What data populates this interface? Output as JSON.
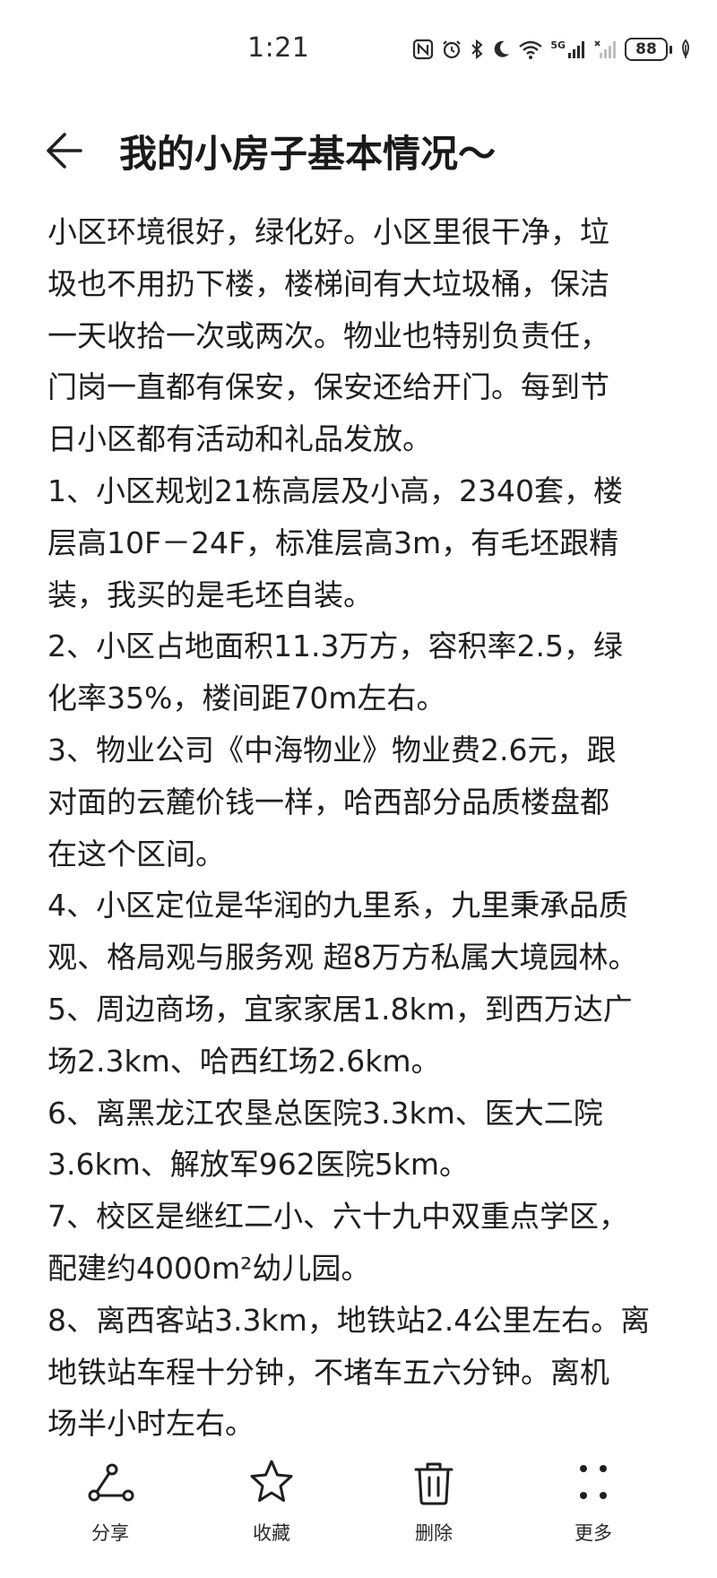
{
  "status_bar": {
    "time": "1:21",
    "battery": "88",
    "network": "5G"
  },
  "header": {
    "title": "我的小房子基本情况～"
  },
  "content": {
    "paragraphs": [
      [
        "小区环境很好，绿化好。小区里很干净，垃",
        "圾也不用扔下楼，楼梯间有大垃圾桶，保洁",
        "一天收拾一次或两次。物业也特别负责任，",
        "门岗一直都有保安，保安还给开门。每到节",
        "日小区都有活动和礼品发放。"
      ],
      [
        "1、小区规划21栋高层及小高，2340套，楼",
        "层高10F－24F，标准层高3m，有毛坯跟精",
        "装，我买的是毛坯自装。"
      ],
      [
        "2、小区占地面积11.3万方，容积率2.5，绿",
        "化率35%，楼间距70m左右。"
      ],
      [
        "3、物业公司《中海物业》物业费2.6元，跟",
        "对面的云麓价钱一样，哈西部分品质楼盘都",
        "在这个区间。"
      ],
      [
        "4、小区定位是华润的九里系，九里秉承品质",
        "观、格局观与服务观 超8万方私属大境园林。"
      ],
      [
        "5、周边商场，宜家家居1.8km，到西万达广",
        "场2.3km、哈西红场2.6km。"
      ],
      [
        "6、离黑龙江农垦总医院3.3km、医大二院",
        "3.6km、解放军962医院5km。"
      ],
      [
        "7、校区是继红二小、六十九中双重点学区，",
        "配建约4000m²幼儿园。"
      ],
      [
        "8、离西客站3.3km，地铁站2.4公里左右。离",
        "地铁站车程十分钟，不堵车五六分钟。离机",
        "场半小时左右。"
      ]
    ]
  },
  "toolbar": {
    "share_label": "分享",
    "collect_label": "收藏",
    "delete_label": "删除",
    "more_label": "更多"
  },
  "colors": {
    "text": "#1f1f1f",
    "background": "#ffffff"
  },
  "icons": {
    "back": "arrow-left-icon",
    "share": "share-icon",
    "collect": "star-icon",
    "delete": "trash-icon",
    "more": "more-dots-icon"
  }
}
